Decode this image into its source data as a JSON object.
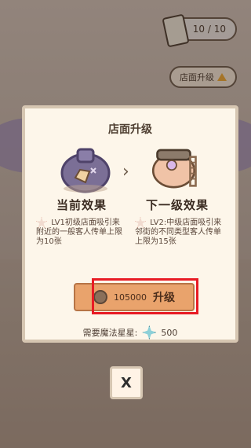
{
  "hud": {
    "tickets_value": "10 / 10",
    "tickets_icon": "ticket-icon",
    "upgrade_store_label": "店面升级",
    "upgrade_store_icon": "arrow-up-icon"
  },
  "modal": {
    "title": "店面升级",
    "current_title": "当前效果",
    "next_title": "下一级效果",
    "current_desc": "LV1初级店面吸引来附近的一般客人传单上限为10张",
    "next_desc": "LV2:中级店面吸引来邻街的不同类型客人传单上限为15张",
    "upgrade_button": {
      "cost": "105000",
      "label": "升级",
      "coin_icon": "coin-icon"
    },
    "requirement": {
      "label": "需要魔法星星:",
      "value": "500",
      "gem_icon": "magic-star-icon"
    }
  },
  "close_label": "X",
  "colors": {
    "modal_bg": "#fdf6ea",
    "button_bg": "#e9a36c",
    "highlight": "#e81b24"
  }
}
